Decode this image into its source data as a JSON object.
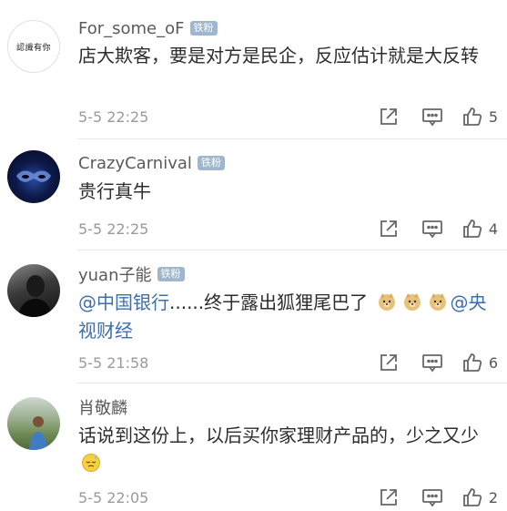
{
  "comments": [
    {
      "user": "For_some_oF",
      "badge": "铁粉",
      "text": "店大欺客，要是对方是民企，反应估计就是大反转",
      "time": "5-5 22:25",
      "likes": "5",
      "avatar_text": "認識有你"
    },
    {
      "user": "CrazyCarnival",
      "badge": "铁粉",
      "text": "贵行真牛",
      "time": "5-5 22:25",
      "likes": "4"
    },
    {
      "user": "yuan子能",
      "badge": "铁粉",
      "mention1": "@中国银行",
      "text_mid": "......终于露出狐狸尾巴了",
      "mention2": "@央视财经",
      "time": "5-5 21:58",
      "likes": "6"
    },
    {
      "user": "肖敬麟",
      "text": "话说到这份上，以后买你家理财产品的，少之又少",
      "time": "5-5 22:05",
      "likes": "2"
    }
  ],
  "icons": {
    "share": "share-icon",
    "comment": "comment-icon",
    "like": "thumbs-up-icon"
  },
  "colors": {
    "mention": "#3c6fb0",
    "badge": "#9fb6cf",
    "time": "#9a9a9a"
  }
}
